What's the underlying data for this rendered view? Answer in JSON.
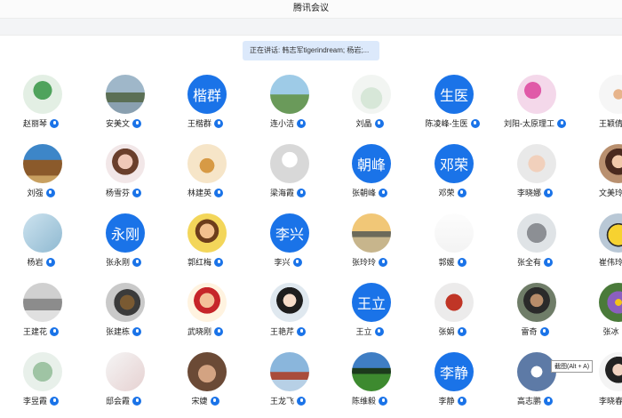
{
  "window": {
    "title": "腾讯会议"
  },
  "speaking": {
    "text": "正在讲话: 韩志军tigerindream; 杨岩;..."
  },
  "tooltip": {
    "text": "截图(Alt + A)"
  },
  "colors": {
    "accent": "#1a73e8",
    "speaker_bg": "#dce9fb"
  },
  "rows": [
    [
      {
        "name": "赵丽琴",
        "avatar_text": "",
        "img": "plant"
      },
      {
        "name": "安美文",
        "avatar_text": "",
        "img": "lake"
      },
      {
        "name": "王楷群",
        "avatar_text": "楷群",
        "img": ""
      },
      {
        "name": "连小洁",
        "avatar_text": "",
        "img": "sky"
      },
      {
        "name": "刘晶",
        "avatar_text": "",
        "img": "white"
      },
      {
        "name": "陈凌峰-生医",
        "avatar_text": "生医",
        "img": ""
      },
      {
        "name": "刘阳-太原理工",
        "avatar_text": "",
        "img": "orchid"
      },
      {
        "name": "王颖倩",
        "avatar_text": "",
        "img": "figure"
      }
    ],
    [
      {
        "name": "刘强",
        "avatar_text": "",
        "img": "horse"
      },
      {
        "name": "杨雪芬",
        "avatar_text": "",
        "img": "girl"
      },
      {
        "name": "林建英",
        "avatar_text": "",
        "img": "tea"
      },
      {
        "name": "梁海霞",
        "avatar_text": "",
        "img": "draw"
      },
      {
        "name": "张朝峰",
        "avatar_text": "朝峰",
        "img": ""
      },
      {
        "name": "邓荣",
        "avatar_text": "邓荣",
        "img": ""
      },
      {
        "name": "李晓娜",
        "avatar_text": "",
        "img": "baby"
      },
      {
        "name": "文美玲",
        "avatar_text": "",
        "img": "woman"
      }
    ],
    [
      {
        "name": "杨岩",
        "avatar_text": "",
        "img": "map"
      },
      {
        "name": "张永刚",
        "avatar_text": "永刚",
        "img": ""
      },
      {
        "name": "郭红梅",
        "avatar_text": "",
        "img": "cartoon"
      },
      {
        "name": "李兴",
        "avatar_text": "李兴",
        "img": ""
      },
      {
        "name": "张玲玲",
        "avatar_text": "",
        "img": "sunset"
      },
      {
        "name": "郭媛",
        "avatar_text": "",
        "img": "family"
      },
      {
        "name": "张全有",
        "avatar_text": "",
        "img": "cat"
      },
      {
        "name": "崔伟玲",
        "avatar_text": "",
        "img": "pika"
      }
    ],
    [
      {
        "name": "王建花",
        "avatar_text": "",
        "img": "cars"
      },
      {
        "name": "张建栋",
        "avatar_text": "",
        "img": "speaker"
      },
      {
        "name": "武晓刚",
        "avatar_text": "",
        "img": "boy"
      },
      {
        "name": "王艳芹",
        "avatar_text": "",
        "img": "anime"
      },
      {
        "name": "王立",
        "avatar_text": "王立",
        "img": ""
      },
      {
        "name": "张娟",
        "avatar_text": "",
        "img": "dragon"
      },
      {
        "name": "雷奇",
        "avatar_text": "",
        "img": "man"
      },
      {
        "name": "张冰",
        "avatar_text": "",
        "img": "flower"
      }
    ],
    [
      {
        "name": "李昱霞",
        "avatar_text": "",
        "img": "succulent"
      },
      {
        "name": "邸会霞",
        "avatar_text": "",
        "img": "art"
      },
      {
        "name": "宋婕",
        "avatar_text": "",
        "img": "hand"
      },
      {
        "name": "王龙飞",
        "avatar_text": "",
        "img": "tower"
      },
      {
        "name": "陈维毅",
        "avatar_text": "",
        "img": "field"
      },
      {
        "name": "李静",
        "avatar_text": "李静",
        "img": ""
      },
      {
        "name": "高志鹏",
        "avatar_text": "",
        "img": "bird"
      },
      {
        "name": "李晓春",
        "avatar_text": "",
        "img": "lady"
      }
    ]
  ]
}
